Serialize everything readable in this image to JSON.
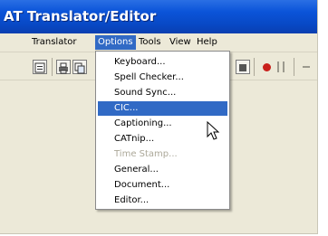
{
  "window": {
    "title": "AT Translator/Editor"
  },
  "menubar": {
    "items": [
      "Translator",
      "Options",
      "Tools",
      "View",
      "Help"
    ],
    "open_index": 1
  },
  "toolbar": {
    "buttons": [
      "document-icon",
      "print-icon",
      "copy-icon",
      "stop-icon",
      "record-icon",
      "pause-icon"
    ]
  },
  "options_menu": {
    "items": [
      {
        "label": "Keyboard...",
        "state": "enabled"
      },
      {
        "label": "Spell Checker...",
        "state": "enabled"
      },
      {
        "label": "Sound Sync...",
        "state": "enabled"
      },
      {
        "label": "CIC...",
        "state": "highlighted"
      },
      {
        "label": "Captioning...",
        "state": "enabled"
      },
      {
        "label": "CATnip...",
        "state": "enabled"
      },
      {
        "label": "Time Stamp...",
        "state": "disabled"
      },
      {
        "label": "General...",
        "state": "enabled"
      },
      {
        "label": "Document...",
        "state": "enabled"
      },
      {
        "label": "Editor...",
        "state": "enabled"
      }
    ]
  },
  "colors": {
    "titlebar": "#0b54d9",
    "highlight": "#316ac5",
    "disabled_text": "#aca899",
    "record": "#c8201b"
  }
}
